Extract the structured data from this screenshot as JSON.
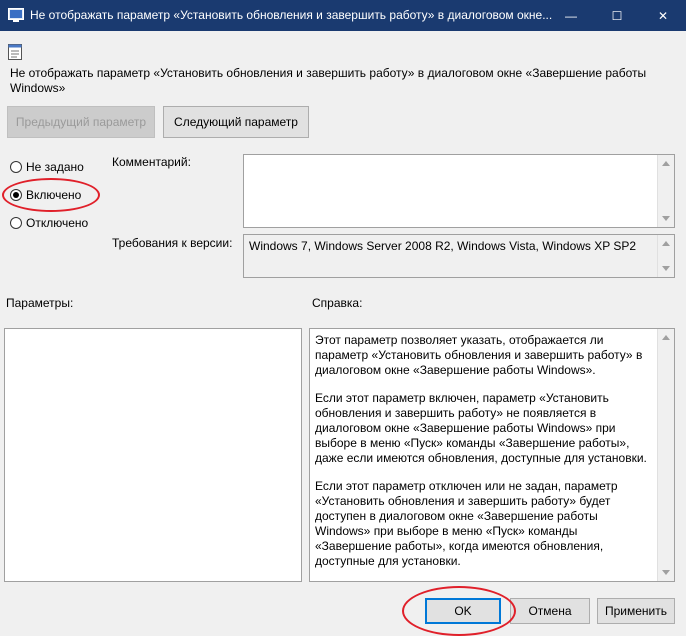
{
  "window": {
    "title": "Не отображать параметр «Установить обновления и завершить работу» в диалоговом окне...",
    "minimize_glyph": "—",
    "maximize_glyph": "☐",
    "close_glyph": "✕"
  },
  "policy": {
    "name": "Не отображать параметр «Установить обновления и завершить работу» в диалоговом окне «Завершение работы Windows»"
  },
  "nav": {
    "prev_label": "Предыдущий параметр",
    "next_label": "Следующий параметр"
  },
  "state": {
    "options": [
      {
        "label": "Не задано",
        "checked": false
      },
      {
        "label": "Включено",
        "checked": true
      },
      {
        "label": "Отключено",
        "checked": false
      }
    ]
  },
  "comment": {
    "label": "Комментарий:",
    "value": ""
  },
  "requirements": {
    "label": "Требования к версии:",
    "value": "Windows 7, Windows Server 2008 R2, Windows Vista, Windows XP SP2"
  },
  "parameters": {
    "label": "Параметры:"
  },
  "help": {
    "label": "Справка:",
    "paragraphs": [
      "Этот параметр позволяет указать, отображается ли параметр «Установить обновления и завершить работу» в диалоговом окне «Завершение работы Windows».",
      "Если этот параметр включен, параметр «Установить обновления и завершить работу» не появляется в диалоговом окне «Завершение работы Windows» при выборе в меню «Пуск» команды «Завершение работы», даже если имеются обновления, доступные для установки.",
      "Если этот параметр отключен или не задан, параметр «Установить обновления и завершить работу» будет доступен в диалоговом окне «Завершение работы Windows» при выборе в меню «Пуск» команды «Завершение работы», когда имеются обновления, доступные для установки."
    ]
  },
  "footer": {
    "ok_label": "OK",
    "cancel_label": "Отмена",
    "apply_label": "Применить"
  },
  "colors": {
    "titlebar": "#1a3a70",
    "highlight_ellipse": "#e0202a",
    "accent": "#0078d7"
  }
}
